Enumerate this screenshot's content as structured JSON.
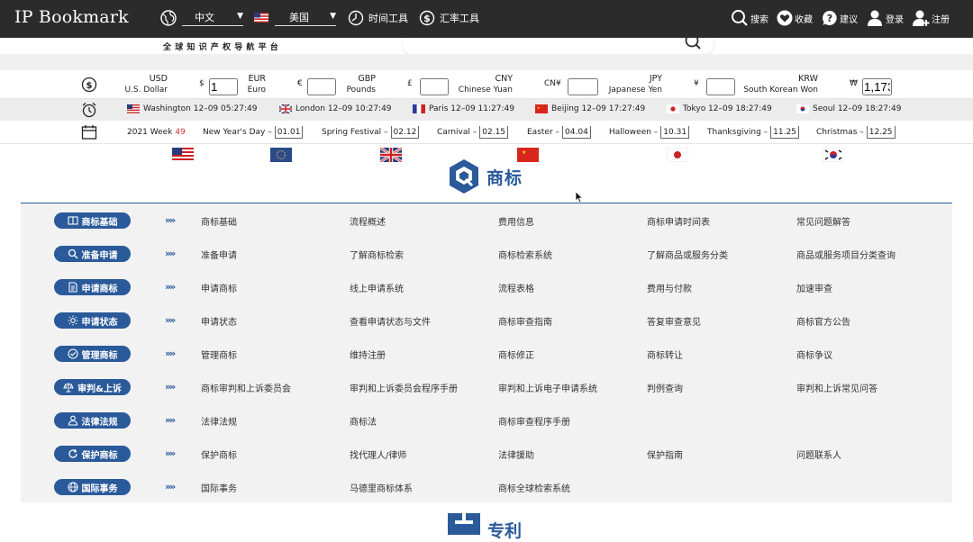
{
  "app": {
    "logo": "IP Bookmark",
    "slogan": "全球知识产权导航平台"
  },
  "topbar": {
    "language": "中文",
    "country": "美国",
    "tools": [
      {
        "label": "时间工具",
        "icon": "clock-tool-icon"
      },
      {
        "label": "汇率工具",
        "icon": "dollar-tool-icon"
      }
    ],
    "actions": [
      {
        "label": "搜索",
        "icon": "search-icon"
      },
      {
        "label": "收藏",
        "icon": "heart-icon"
      },
      {
        "label": "建议",
        "icon": "question-icon"
      },
      {
        "label": "登录",
        "icon": "user-icon"
      },
      {
        "label": "注册",
        "icon": "add-user-icon"
      }
    ]
  },
  "search": {
    "placeholder": ""
  },
  "currencies": [
    {
      "code": "USD",
      "name": "U.S. Dollar",
      "symbol": "$",
      "value": "1",
      "flag": "us"
    },
    {
      "code": "EUR",
      "name": "Euro",
      "symbol": "€",
      "value": "",
      "flag": "eu"
    },
    {
      "code": "GBP",
      "name": "Pounds",
      "symbol": "£",
      "value": "",
      "flag": "uk"
    },
    {
      "code": "CNY",
      "name": "Chinese Yuan",
      "symbol": "CN¥",
      "value": "",
      "flag": "cn"
    },
    {
      "code": "JPY",
      "name": "Japanese Yen",
      "symbol": "¥",
      "value": "",
      "flag": "jp"
    },
    {
      "code": "KRW",
      "name": "South Korean Won",
      "symbol": "₩",
      "value": "1,173.",
      "flag": "kr"
    }
  ],
  "timezones": [
    {
      "label": "Washington 12–09 05:27:49",
      "flag": "us"
    },
    {
      "label": "London 12–09 10:27:49",
      "flag": "uk"
    },
    {
      "label": "Paris 12–09 11:27:49",
      "flag": "fr"
    },
    {
      "label": "Beijing 12–09 17:27:49",
      "flag": "cn"
    },
    {
      "label": "Tokyo 12–09 18:27:49",
      "flag": "jp"
    },
    {
      "label": "Seoul 12–09 18:27:49",
      "flag": "kr"
    }
  ],
  "week": {
    "prefix": "2021 Week",
    "number": "49"
  },
  "holidays": [
    {
      "name": "New Year's Day –",
      "date": "01.01"
    },
    {
      "name": "Spring Festival –",
      "date": "02.12"
    },
    {
      "name": "Carnival –",
      "date": "02.15"
    },
    {
      "name": "Easter –",
      "date": "04.04"
    },
    {
      "name": "Halloween –",
      "date": "10.31"
    },
    {
      "name": "Thanksgiving –",
      "date": "11.25"
    },
    {
      "name": "Christmas –",
      "date": "12.25"
    }
  ],
  "section": {
    "title": "商标"
  },
  "next_section": {
    "title": "专利"
  },
  "categories": [
    {
      "label": "商标基础",
      "icon": "book-icon",
      "links": [
        "商标基础",
        "流程概述",
        "费用信息",
        "商标申请时间表",
        "常见问题解答"
      ]
    },
    {
      "label": "准备申请",
      "icon": "search-icon",
      "links": [
        "准备申请",
        "了解商标检索",
        "商标检索系统",
        "了解商品或服务分类",
        "商品或服务项目分类查询"
      ]
    },
    {
      "label": "申请商标",
      "icon": "document-icon",
      "links": [
        "申请商标",
        "线上申请系统",
        "流程表格",
        "费用与付款",
        "加速审查"
      ]
    },
    {
      "label": "申请状态",
      "icon": "sun-icon",
      "links": [
        "申请状态",
        "查看申请状态与文件",
        "商标审查指南",
        "答复审查意见",
        "商标官方公告"
      ]
    },
    {
      "label": "管理商标",
      "icon": "check-circle-icon",
      "links": [
        "管理商标",
        "维持注册",
        "商标修正",
        "商标转让",
        "商标争议"
      ]
    },
    {
      "label": "审判&上诉",
      "icon": "scale-icon",
      "links": [
        "商标审判和上诉委员会",
        "审判和上诉委员会程序手册",
        "审判和上诉电子申请系统",
        "判例查询",
        "审判和上诉常见问答"
      ]
    },
    {
      "label": "法律法规",
      "icon": "person-icon",
      "links": [
        "法律法规",
        "商标法",
        "商标审查程序手册",
        "",
        ""
      ]
    },
    {
      "label": "保护商标",
      "icon": "refresh-icon",
      "links": [
        "保护商标",
        "找代理人/律师",
        "法律援助",
        "保护指南",
        "问题联系人"
      ]
    },
    {
      "label": "国际事务",
      "icon": "globe-icon",
      "links": [
        "国际事务",
        "马德里商标体系",
        "商标全球检索系统",
        "",
        ""
      ]
    }
  ]
}
